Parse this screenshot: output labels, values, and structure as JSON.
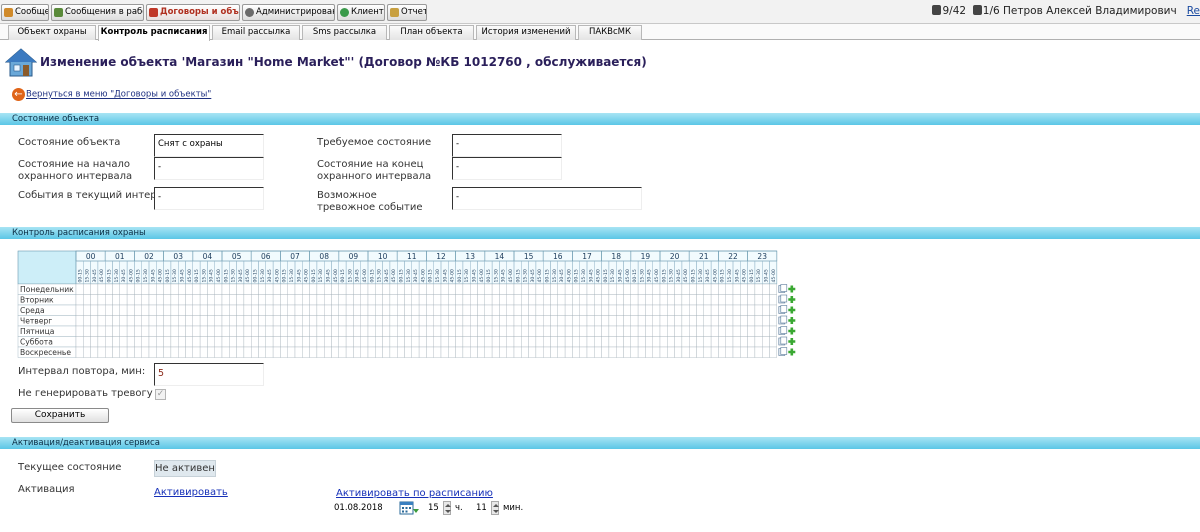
{
  "nav_tabs": [
    {
      "label": "Сообщения",
      "color": "#d08a2a"
    },
    {
      "label": "Сообщения в работе",
      "color": "#5a8a3a"
    },
    {
      "label": "Договоры и объекты",
      "color": "#c03828",
      "active": true
    },
    {
      "label": "Администрирование",
      "color": "#6a6a6a"
    },
    {
      "label": "Клиенты",
      "color": "#3a9a4a"
    },
    {
      "label": "Отчеты",
      "color": "#c8a040"
    }
  ],
  "user": {
    "counter": "9/42",
    "shift": "1/6",
    "name": "Петров Алексей Владимирович",
    "exit": "Re"
  },
  "sub_tabs": [
    "Объект охраны",
    "Контроль расписания",
    "Email рассылка",
    "Sms рассылка",
    "План объекта",
    "История изменений",
    "ПАКВсМК"
  ],
  "active_sub_tab": "Контроль расписания",
  "page_title": "Изменение объекта 'Магазин \"Home Market\"' (Договор №КБ 1012760 , обслуживается)",
  "back_link": "Вернуться в меню \"Договоры и объекты\"",
  "object_state": {
    "section_title": "Состояние объекта",
    "current_label": "Состояние объекта",
    "current_value": "Снят с охраны",
    "required_label": "Требуемое состояние",
    "required_value": "-",
    "start_label": "Состояние на начало охранного интервала",
    "start_value": "-",
    "end_label": "Состояние на конец охранного интервала",
    "end_value": "-",
    "events_label": "События в текущий интервал",
    "events_value": "-",
    "alarm_label": "Возможное тревожное событие",
    "alarm_value": "-"
  },
  "schedule": {
    "section_title": "Контроль расписания охраны",
    "hours": [
      "00",
      "01",
      "02",
      "03",
      "04",
      "05",
      "06",
      "07",
      "08",
      "09",
      "10",
      "11",
      "12",
      "13",
      "14",
      "15",
      "16",
      "17",
      "18",
      "19",
      "20",
      "21",
      "22",
      "23"
    ],
    "quarters": [
      "00-15",
      "15-30",
      "30-45",
      "45-00"
    ],
    "days": [
      "Понедельник",
      "Вторник",
      "Среда",
      "Четверг",
      "Пятница",
      "Суббота",
      "Воскресенье"
    ],
    "repeat_label": "Интервал повтора, мин:",
    "repeat_value": "5",
    "no_alarm_label": "Не генерировать тревогу",
    "no_alarm_checked": true,
    "save_label": "Сохранить"
  },
  "activation": {
    "section_title": "Активация/деактивация сервиса",
    "status_label": "Текущее состояние",
    "status_value": "Не активен",
    "activation_label": "Активация",
    "activate_link": "Активировать",
    "schedule_link": "Активировать по расписанию",
    "date": "01.08.2018",
    "hour": "15",
    "hour_unit": "ч.",
    "minute": "11",
    "minute_unit": "мин."
  },
  "colors": {
    "section": "#5bc6e6",
    "grid_header": "#cdeef8",
    "link": "#1630b8",
    "add_plus": "#3aa832"
  }
}
